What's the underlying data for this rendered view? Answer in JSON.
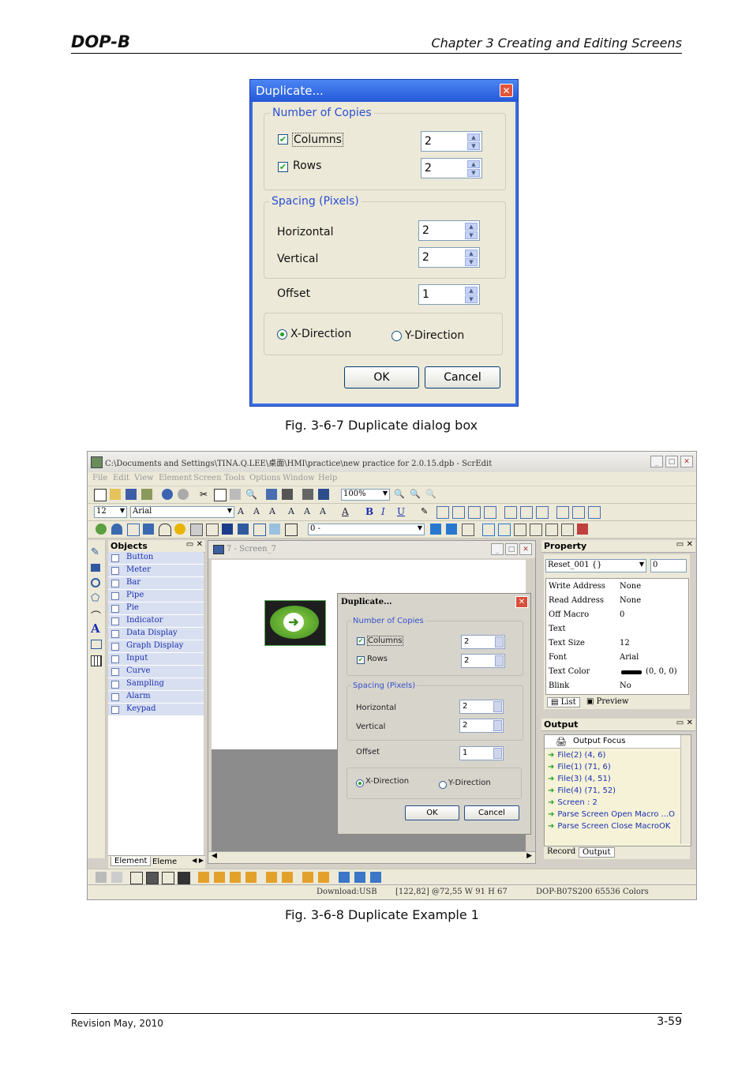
{
  "header": {
    "logo": "DOP-B",
    "chapter": "Chapter 3 Creating and Editing Screens"
  },
  "figure1": {
    "caption": "Fig. 3-6-7 Duplicate dialog box",
    "dialog": {
      "title": "Duplicate...",
      "copies_group": "Number of Copies",
      "columns_label": "Columns",
      "columns_checked": true,
      "columns_value": "2",
      "rows_label": "Rows",
      "rows_checked": true,
      "rows_value": "2",
      "spacing_group": "Spacing (Pixels)",
      "horizontal_label": "Horizontal",
      "horizontal_value": "2",
      "vertical_label": "Vertical",
      "vertical_value": "2",
      "offset_label": "Offset",
      "offset_value": "1",
      "x_direction": "X-Direction",
      "y_direction": "Y-Direction",
      "selected_direction": "X-Direction",
      "ok": "OK",
      "cancel": "Cancel"
    }
  },
  "figure2": {
    "caption": "Fig. 3-6-8 Duplicate Example 1",
    "app": {
      "title": "C:\\Documents and Settings\\TINA.Q.LEE\\桌面\\HMI\\practice\\new practice for 2.0.15.dpb - ScrEdit",
      "menu": [
        "File",
        "Edit",
        "View",
        "Element",
        "Screen",
        "Tools",
        "Options",
        "Window",
        "Help"
      ],
      "zoom": "100%",
      "font_size": "12",
      "font_name": "Arial",
      "state_select": "0 -",
      "objects_title": "Objects",
      "objects": [
        "Button",
        "Meter",
        "Bar",
        "Pipe",
        "Pie",
        "Indicator",
        "Data Display",
        "Graph Display",
        "Input",
        "Curve",
        "Sampling",
        "Alarm",
        "Keypad"
      ],
      "left_tabs": [
        "Element",
        "Eleme"
      ],
      "screen_title": "7 - Screen_7",
      "property_title": "Property",
      "property_select": "Reset_001 {}",
      "property_value_box": "0",
      "properties": [
        {
          "name": "Write Address",
          "value": "None"
        },
        {
          "name": "Read Address",
          "value": "None"
        },
        {
          "name": "Off Macro",
          "value": "0"
        },
        {
          "name": "Text",
          "value": ""
        },
        {
          "name": "Text Size",
          "value": "12"
        },
        {
          "name": "Font",
          "value": "Arial"
        },
        {
          "name": "Text Color",
          "value": "(0, 0, 0)"
        },
        {
          "name": "Blink",
          "value": "No"
        }
      ],
      "property_tabs": [
        "List",
        "Preview"
      ],
      "output_title": "Output",
      "output_header": "Output Focus",
      "output_lines": [
        "File(2) (4, 6)",
        "File(1) (71, 6)",
        "File(3) (4, 51)",
        "File(4) (71, 52)",
        "Screen : 2",
        "Parse Screen Open Macro ...O",
        "Parse Screen Close MacroOK"
      ],
      "output_tabs": [
        "Record",
        "Output"
      ],
      "status": {
        "download": "Download:USB",
        "coords": "[122,82] @72,55 W 91 H 67",
        "model": "DOP-B07S200 65536 Colors"
      },
      "dialog": {
        "title": "Duplicate...",
        "copies_group": "Number of Copies",
        "columns_label": "Columns",
        "columns_value": "2",
        "rows_label": "Rows",
        "rows_value": "2",
        "spacing_group": "Spacing (Pixels)",
        "horizontal_label": "Horizontal",
        "horizontal_value": "2",
        "vertical_label": "Vertical",
        "vertical_value": "2",
        "offset_label": "Offset",
        "offset_value": "1",
        "x_direction": "X-Direction",
        "y_direction": "Y-Direction",
        "ok": "OK",
        "cancel": "Cancel"
      }
    }
  },
  "footer": {
    "revision": "Revision May, 2010",
    "page": "3-59"
  }
}
